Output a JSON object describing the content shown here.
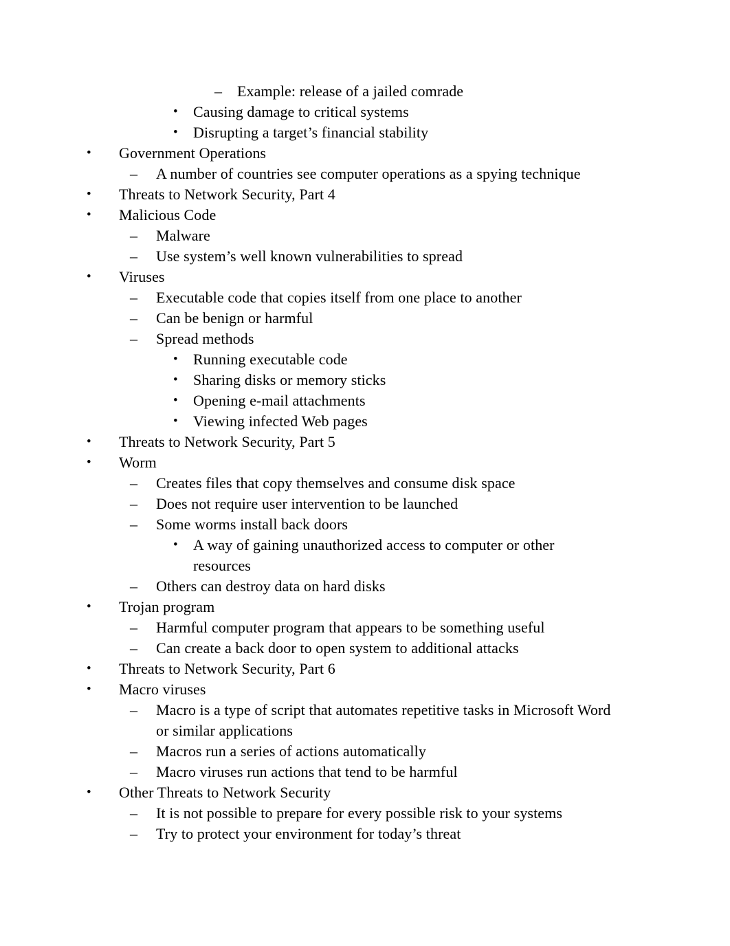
{
  "document": {
    "page_background": "#ffffff",
    "text_color": "#000000",
    "markers": {
      "bullet": "•",
      "dash": "–"
    },
    "outline": [
      {
        "level": 4,
        "marker": "dash",
        "text": "Example: release of a jailed comrade"
      },
      {
        "level": 3,
        "marker": "bullet",
        "text": "Causing damage to critical systems"
      },
      {
        "level": 3,
        "marker": "bullet",
        "text": "Disrupting a target’s financial stability"
      },
      {
        "level": 1,
        "marker": "bullet",
        "text": "Government Operations"
      },
      {
        "level": 2,
        "marker": "dash",
        "text": "A number of countries see computer operations as a spying technique"
      },
      {
        "level": 1,
        "marker": "bullet",
        "text": "Threats to Network Security, Part 4"
      },
      {
        "level": 1,
        "marker": "bullet",
        "text": "Malicious Code"
      },
      {
        "level": 2,
        "marker": "dash",
        "text": "Malware"
      },
      {
        "level": 2,
        "marker": "dash",
        "text": "Use system’s well known vulnerabilities to spread"
      },
      {
        "level": 1,
        "marker": "bullet",
        "text": "Viruses"
      },
      {
        "level": 2,
        "marker": "dash",
        "text": "Executable code that copies itself from one place to another"
      },
      {
        "level": 2,
        "marker": "dash",
        "text": "Can be benign or harmful"
      },
      {
        "level": 2,
        "marker": "dash",
        "text": "Spread methods"
      },
      {
        "level": 3,
        "marker": "bullet",
        "text": "Running executable code"
      },
      {
        "level": 3,
        "marker": "bullet",
        "text": "Sharing disks or memory sticks"
      },
      {
        "level": 3,
        "marker": "bullet",
        "text": "Opening e-mail attachments"
      },
      {
        "level": 3,
        "marker": "bullet",
        "text": "Viewing infected Web pages"
      },
      {
        "level": 1,
        "marker": "bullet",
        "text": "Threats to Network Security, Part 5"
      },
      {
        "level": 1,
        "marker": "bullet",
        "text": "Worm"
      },
      {
        "level": 2,
        "marker": "dash",
        "text": "Creates files that copy themselves and consume disk space"
      },
      {
        "level": 2,
        "marker": "dash",
        "text": "Does not require user intervention to be launched"
      },
      {
        "level": 2,
        "marker": "dash",
        "text": "Some worms install back doors"
      },
      {
        "level": 3,
        "marker": "bullet",
        "text": "A way of gaining unauthorized access to computer or other resources"
      },
      {
        "level": 2,
        "marker": "dash",
        "text": "Others can destroy data on hard disks"
      },
      {
        "level": 1,
        "marker": "bullet",
        "text": "Trojan program"
      },
      {
        "level": 2,
        "marker": "dash",
        "text": "Harmful computer program that appears to be something useful"
      },
      {
        "level": 2,
        "marker": "dash",
        "text": "Can create a back door to open system to additional attacks"
      },
      {
        "level": 1,
        "marker": "bullet",
        "text": "Threats to Network Security, Part 6"
      },
      {
        "level": 1,
        "marker": "bullet",
        "text": "Macro viruses"
      },
      {
        "level": 2,
        "marker": "dash",
        "text": "Macro is a type of script that automates repetitive tasks in Microsoft Word or similar applications"
      },
      {
        "level": 2,
        "marker": "dash",
        "text": "Macros run a series of actions automatically"
      },
      {
        "level": 2,
        "marker": "dash",
        "text": "Macro viruses run actions that tend to be harmful"
      },
      {
        "level": 1,
        "marker": "bullet",
        "text": "Other Threats to Network Security"
      },
      {
        "level": 2,
        "marker": "dash",
        "text": "It is not possible to prepare for every possible risk to your systems"
      },
      {
        "level": 2,
        "marker": "dash",
        "text": "Try to protect your environment for today’s threat"
      }
    ]
  }
}
